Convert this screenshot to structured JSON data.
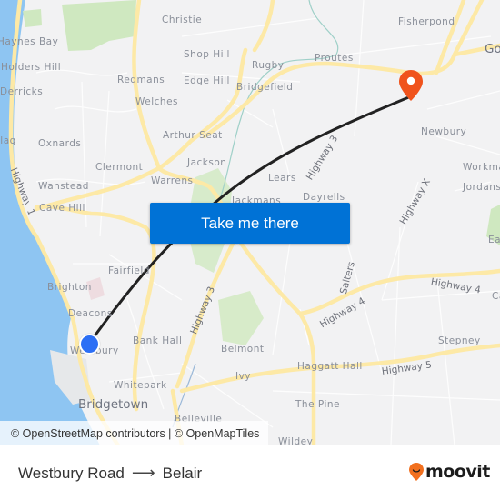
{
  "map": {
    "cta_label": "Take me there",
    "attribution": "© OpenStreetMap contributors | © OpenMapTiles",
    "colors": {
      "land": "#f2f2f3",
      "water": "#8ec5f2",
      "park": "#cfe8c0",
      "major_road": "#fde9a6",
      "route_line": "#222222",
      "origin_marker": "#2c6ff5",
      "destination_marker": "#f0531c",
      "cta_background": "#0072d6"
    },
    "places": [
      {
        "name": "Christie"
      },
      {
        "name": "Haynes Bay"
      },
      {
        "name": "Holders Hill"
      },
      {
        "name": "Shop Hill"
      },
      {
        "name": "Rugby"
      },
      {
        "name": "Proutes"
      },
      {
        "name": "Fisherpond"
      },
      {
        "name": "Redmans"
      },
      {
        "name": "Edge Hill"
      },
      {
        "name": "Bridgefield"
      },
      {
        "name": "Derricks"
      },
      {
        "name": "Welches"
      },
      {
        "name": "Arthur Seat"
      },
      {
        "name": "Oxnards"
      },
      {
        "name": "Jackson"
      },
      {
        "name": "Clermont"
      },
      {
        "name": "Warrens"
      },
      {
        "name": "Lears"
      },
      {
        "name": "Wanstead"
      },
      {
        "name": "Cave Hill"
      },
      {
        "name": "Jackmans"
      },
      {
        "name": "Dayrells"
      },
      {
        "name": "Newbury"
      },
      {
        "name": "Workman"
      },
      {
        "name": "Jordans"
      },
      {
        "name": "Fairfield"
      },
      {
        "name": "Brighton"
      },
      {
        "name": "Deacons"
      },
      {
        "name": "Westbury"
      },
      {
        "name": "Bank Hall"
      },
      {
        "name": "Belmont"
      },
      {
        "name": "Whitepark"
      },
      {
        "name": "Ivy"
      },
      {
        "name": "Haggatt Hall"
      },
      {
        "name": "Stepney"
      },
      {
        "name": "Bridgetown"
      },
      {
        "name": "Belleville"
      },
      {
        "name": "The Pine"
      },
      {
        "name": "Wildey"
      },
      {
        "name": "Salters"
      },
      {
        "name": "Villag"
      },
      {
        "name": "Go"
      },
      {
        "name": "Ea"
      },
      {
        "name": "Ca"
      }
    ],
    "roads": [
      {
        "name": "Highway 1"
      },
      {
        "name": "Highway 3"
      },
      {
        "name": "Highway 3"
      },
      {
        "name": "Highway X"
      },
      {
        "name": "Highway 4"
      },
      {
        "name": "Highway 4"
      },
      {
        "name": "Highway 5"
      }
    ]
  },
  "footer": {
    "origin": "Westbury Road",
    "arrow": "⟶",
    "destination": "Belair",
    "brand": "moovit"
  }
}
